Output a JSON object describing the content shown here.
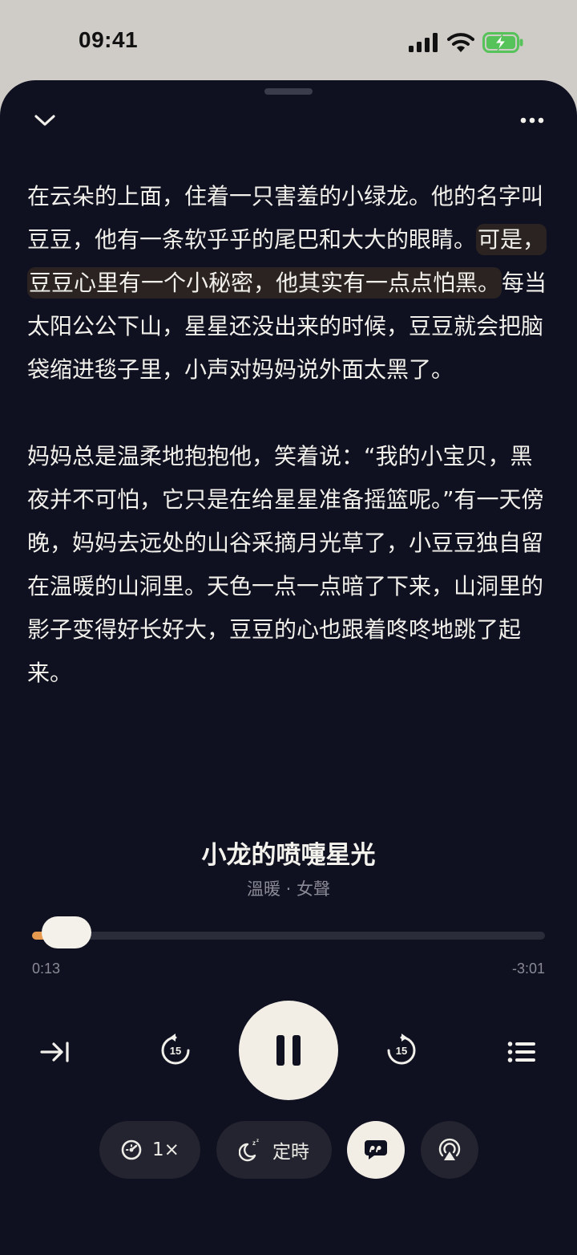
{
  "status": {
    "time": "09:41"
  },
  "story": {
    "p1_before": "在云朵的上面，住着一只害羞的小绿龙。他的名字叫豆豆，他有一条软乎乎的尾巴和大大的眼睛。",
    "p1_highlight": "可是，豆豆心里有一个小秘密，他其实有一点点怕黑。",
    "p1_after": "每当太阳公公下山，星星还没出来的时候，豆豆就会把脑袋缩进毯子里，小声对妈妈说外面太黑了。",
    "p2": "妈妈总是温柔地抱抱他，笑着说：“我的小宝贝，黑夜并不可怕，它只是在给星星准备摇篮呢。”有一天傍晚，妈妈去远处的山谷采摘月光草了，小豆豆独自留在温暖的山洞里。天色一点一点暗了下来，山洞里的影子变得好长好大，豆豆的心也跟着咚咚地跳了起来。"
  },
  "player": {
    "title": "小龙的喷嚏星光",
    "subtitle": "溫暖 · 女聲",
    "elapsed": "0:13",
    "remaining": "-3:01",
    "progress_fraction": 0.067,
    "accent_color": "#e59a4f",
    "speed_label": "1×",
    "timer_label": "定時",
    "rewind_seconds": "15",
    "forward_seconds": "15"
  },
  "icons": {
    "collapse": "chevron-down-icon",
    "more": "more-icon",
    "skip": "skip-to-end-icon",
    "rewind": "rewind-15-icon",
    "play": "pause-icon",
    "forward": "forward-15-icon",
    "playlist": "playlist-icon",
    "speed": "speedometer-icon",
    "timer": "moon-sleep-icon",
    "transcript": "quote-bubble-icon",
    "airplay": "airplay-audio-icon"
  }
}
